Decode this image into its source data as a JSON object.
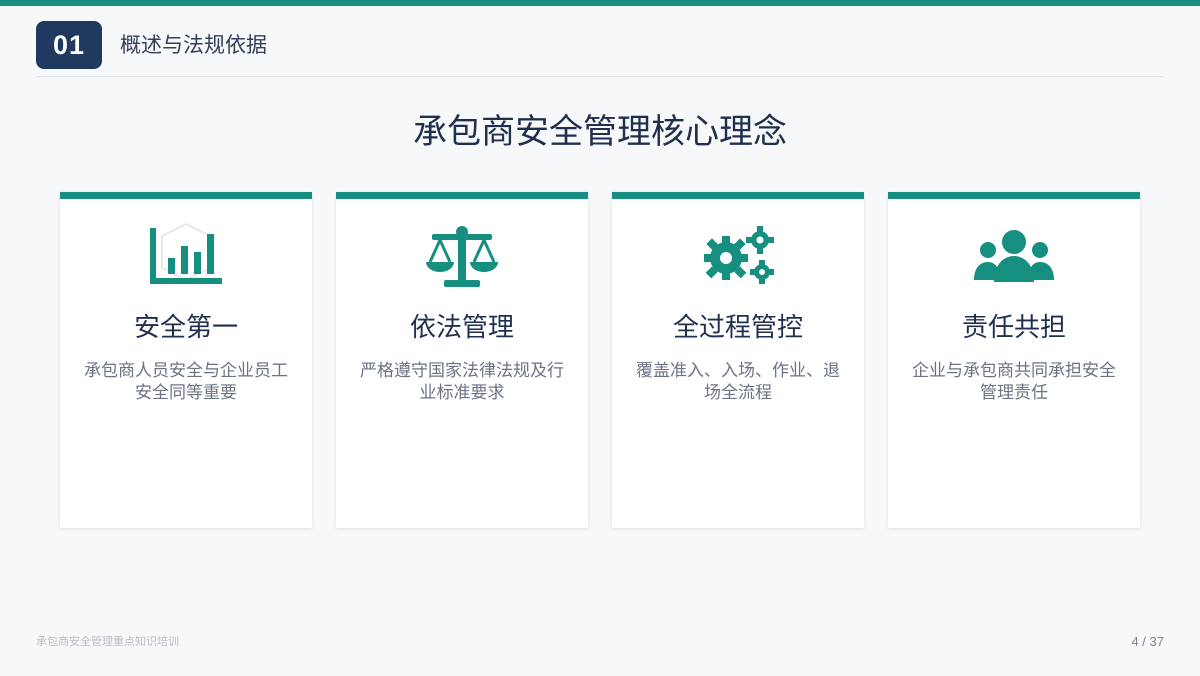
{
  "header": {
    "section_number": "01",
    "section_title": "概述与法规依据"
  },
  "main": {
    "title": "承包商安全管理核心理念",
    "cards": [
      {
        "icon": "bar-chart-icon",
        "title": "安全第一",
        "description": "承包商人员安全与企业员工安全同等重要"
      },
      {
        "icon": "balance-scale-icon",
        "title": "依法管理",
        "description": "严格遵守国家法律法规及行业标准要求"
      },
      {
        "icon": "gears-icon",
        "title": "全过程管控",
        "description": "覆盖准入、入场、作业、退场全流程"
      },
      {
        "icon": "users-group-icon",
        "title": "责任共担",
        "description": "企业与承包商共同承担安全管理责任"
      }
    ]
  },
  "footer": {
    "course_name": "承包商安全管理重点知识培训",
    "page_indicator": "4 / 37"
  },
  "colors": {
    "accent": "#168f80",
    "badge": "#1f3a5e",
    "title": "#1f2f4d",
    "description": "#6b7385"
  }
}
